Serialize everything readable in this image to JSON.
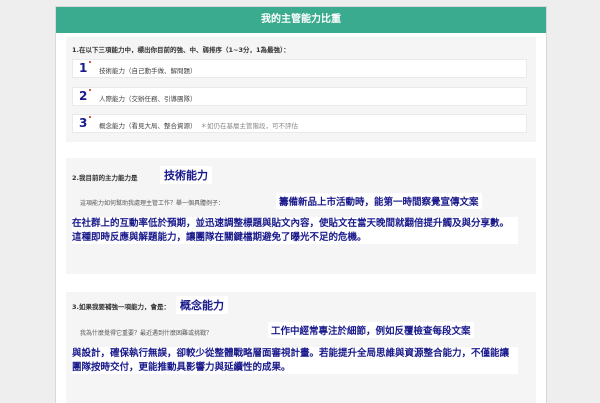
{
  "header": {
    "title": "我的主管能力比重"
  },
  "section1": {
    "question": "1.在以下三項能力中，標出你目前的強、中、弱排序（1~3分，1為最強）：",
    "items": [
      {
        "rank": "1",
        "label": "技術能力（自己動手做、解問題）",
        "note": ""
      },
      {
        "rank": "2",
        "label": "人際能力（交辦任務、引導團隊）",
        "note": ""
      },
      {
        "rank": "3",
        "label": "概念能力（看見大局、整合資源）",
        "note": "＊如仍在基層主管階段，可不評估"
      }
    ]
  },
  "section2": {
    "question": "2.我目前的主力能力是",
    "answer": "技術能力",
    "prompt": "這項能力如何幫助我處理主管工作？舉一個具體例子：",
    "answer_first": "籌備新品上市活動時，能第一時間察覺宣傳文案",
    "answer_rest": "在社群上的互動率低於預期，並迅速調整標題與貼文內容，使貼文在當天晚間就翻倍提升觸及與分享數。這種即時反應與解題能力，讓團隊在關鍵檔期避免了曝光不足的危機。"
  },
  "section3": {
    "question": "3.如果我要補強一項能力，會是：",
    "answer": "概念能力",
    "prompt": "我為什麼覺得它重要？最近遇到什麼困難或挑戰？",
    "answer_first": "工作中經常專注於細節，例如反覆檢查每段文案",
    "answer_rest": "與設計，確保執行無誤，卻較少從整體戰略層面審視計畫。若能提升全局思維與資源整合能力，不僅能讓團隊按時交付，更能推動具影響力與延續性的成果。"
  }
}
